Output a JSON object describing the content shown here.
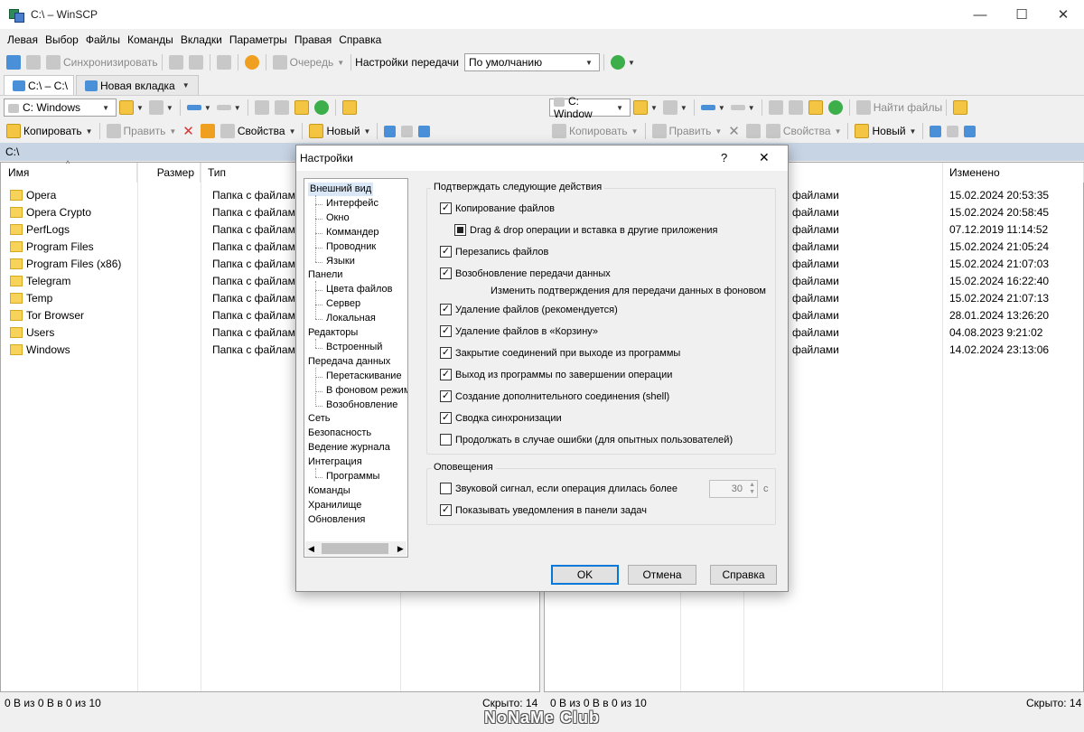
{
  "window": {
    "title": "C:\\ – WinSCP",
    "controls": [
      "—",
      "☐",
      "✕"
    ]
  },
  "menu": [
    "Левая",
    "Выбор",
    "Файлы",
    "Команды",
    "Вкладки",
    "Параметры",
    "Правая",
    "Справка"
  ],
  "toolbar": {
    "sync_label": "Синхронизировать",
    "queue_label": "Очередь",
    "transfer_settings_label": "Настройки передачи",
    "transfer_settings_value": "По умолчанию"
  },
  "tabs": [
    {
      "label": "C:\\ – C:\\"
    },
    {
      "label": "Новая вкладка"
    }
  ],
  "left_panel": {
    "drive": "C: Windows",
    "copy_label": "Копировать",
    "edit_label": "Править",
    "properties_label": "Свойства",
    "new_label": "Новый",
    "path": "C:\\",
    "columns": {
      "name": "Имя",
      "size": "Размер",
      "type": "Тип"
    },
    "rows": [
      {
        "name": "Opera",
        "type": "Папка с файлами"
      },
      {
        "name": "Opera Crypto",
        "type": "Папка с файлами"
      },
      {
        "name": "PerfLogs",
        "type": "Папка с файлами"
      },
      {
        "name": "Program Files",
        "type": "Папка с файлами"
      },
      {
        "name": "Program Files (x86)",
        "type": "Папка с файлами"
      },
      {
        "name": "Telegram",
        "type": "Папка с файлами"
      },
      {
        "name": "Temp",
        "type": "Папка с файлами"
      },
      {
        "name": "Tor Browser",
        "type": "Папка с файлами"
      },
      {
        "name": "Users",
        "type": "Папка с файлами"
      },
      {
        "name": "Windows",
        "type": "Папка с файлами"
      }
    ],
    "status": "0 B из 0 B в 0 из 10",
    "hidden": "Скрыто: 14"
  },
  "right_panel": {
    "drive": "C: Window",
    "find_label": "Найти файлы",
    "copy_label": "Копировать",
    "edit_label": "Править",
    "properties_label": "Свойства",
    "new_label": "Новый",
    "columns": {
      "modified": "Изменено"
    },
    "rows": [
      {
        "type": "файлами",
        "modified": "15.02.2024 20:53:35"
      },
      {
        "type": "файлами",
        "modified": "15.02.2024 20:58:45"
      },
      {
        "type": "файлами",
        "modified": "07.12.2019 11:14:52"
      },
      {
        "type": "файлами",
        "modified": "15.02.2024 21:05:24"
      },
      {
        "type": "файлами",
        "modified": "15.02.2024 21:07:03"
      },
      {
        "type": "файлами",
        "modified": "15.02.2024 16:22:40"
      },
      {
        "type": "файлами",
        "modified": "15.02.2024 21:07:13"
      },
      {
        "type": "файлами",
        "modified": "28.01.2024 13:26:20"
      },
      {
        "type": "файлами",
        "modified": "04.08.2023 9:21:02"
      },
      {
        "type": "файлами",
        "modified": "14.02.2024 23:13:06"
      }
    ],
    "status": "0 B из 0 B в 0 из 10",
    "hidden": "Скрыто: 14"
  },
  "dialog": {
    "title": "Настройки",
    "help_glyph": "?",
    "close_glyph": "✕",
    "tree": [
      {
        "label": "Внешний вид",
        "level": 0,
        "selected": true
      },
      {
        "label": "Интерфейс",
        "level": 1
      },
      {
        "label": "Окно",
        "level": 1
      },
      {
        "label": "Коммандер",
        "level": 1
      },
      {
        "label": "Проводник",
        "level": 1
      },
      {
        "label": "Языки",
        "level": 1
      },
      {
        "label": "Панели",
        "level": 0
      },
      {
        "label": "Цвета файлов",
        "level": 1
      },
      {
        "label": "Сервер",
        "level": 1
      },
      {
        "label": "Локальная",
        "level": 1
      },
      {
        "label": "Редакторы",
        "level": 0
      },
      {
        "label": "Встроенный",
        "level": 1
      },
      {
        "label": "Передача данных",
        "level": 0
      },
      {
        "label": "Перетаскивание",
        "level": 1
      },
      {
        "label": "В фоновом режим",
        "level": 1
      },
      {
        "label": "Возобновление",
        "level": 1
      },
      {
        "label": "Сеть",
        "level": 0
      },
      {
        "label": "Безопасность",
        "level": 0
      },
      {
        "label": "Ведение журнала",
        "level": 0
      },
      {
        "label": "Интеграция",
        "level": 0
      },
      {
        "label": "Программы",
        "level": 1
      },
      {
        "label": "Команды",
        "level": 0
      },
      {
        "label": "Хранилище",
        "level": 0
      },
      {
        "label": "Обновления",
        "level": 0
      }
    ],
    "confirm_group": "Подтверждать следующие действия",
    "confirm_items": [
      {
        "label": "Копирование файлов",
        "state": "checked"
      },
      {
        "label": "Drag & drop операции и вставка в другие приложения",
        "state": "indeterminate"
      },
      {
        "label": "Перезапись файлов",
        "state": "checked"
      },
      {
        "label": "Возобновление передачи данных",
        "state": "checked"
      },
      {
        "label": "Изменить подтверждения для передачи данных в фоновом",
        "state": "link"
      },
      {
        "label": "Удаление файлов (рекомендуется)",
        "state": "checked"
      },
      {
        "label": "Удаление файлов в «Корзину»",
        "state": "checked"
      },
      {
        "label": "Закрытие соединений при выходе из программы",
        "state": "checked"
      },
      {
        "label": "Выход из программы по завершении операции",
        "state": "checked"
      },
      {
        "label": "Создание дополнительного соединения (shell)",
        "state": "checked"
      },
      {
        "label": "Сводка синхронизации",
        "state": "checked"
      },
      {
        "label": "Продолжать в случае ошибки (для опытных пользователей)",
        "state": "unchecked"
      }
    ],
    "notify_group": "Оповещения",
    "beep_label": "Звуковой сигнал, если операция длилась более",
    "beep_checked": false,
    "beep_value": "30",
    "beep_unit": "с",
    "taskbar_label": "Показывать уведомления в панели задач",
    "taskbar_checked": true,
    "ok_label": "OK",
    "cancel_label": "Отмена",
    "help_label": "Справка"
  },
  "watermark": "NoNaMe Club"
}
